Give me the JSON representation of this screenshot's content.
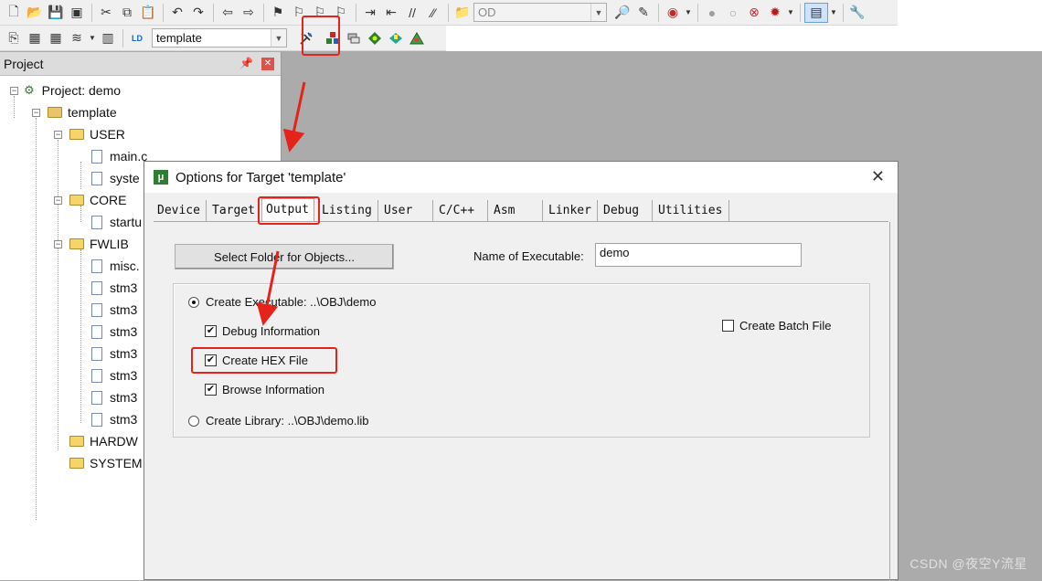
{
  "toolbar": {
    "device_combo_value": "OD",
    "target_combo_value": "template",
    "icons_row1": [
      "new-file-icon",
      "open-folder-icon",
      "save-icon",
      "save-all-icon",
      "cut-icon",
      "copy-icon",
      "paste-icon",
      "undo-icon",
      "redo-icon",
      "nav-back-icon",
      "nav-forward-icon",
      "bookmark-icon",
      "prev-bookmark-icon",
      "next-bookmark-icon",
      "clear-bookmarks-icon",
      "indent-icon",
      "outdent-icon",
      "comment-icon",
      "uncomment-icon",
      "find-in-files-icon"
    ],
    "icons_row2": [
      "translate-icon",
      "build-icon",
      "rebuild-icon",
      "batch-build-icon",
      "stop-build-icon",
      "download-icon"
    ]
  },
  "project": {
    "title": "Project",
    "tree": [
      {
        "label": "Project: demo"
      },
      {
        "label": "template"
      },
      {
        "label": "USER"
      },
      {
        "label": "main.c"
      },
      {
        "label": "syste"
      },
      {
        "label": "CORE"
      },
      {
        "label": "startu"
      },
      {
        "label": "FWLIB"
      },
      {
        "label": "misc."
      },
      {
        "label": "stm3"
      },
      {
        "label": "stm3"
      },
      {
        "label": "stm3"
      },
      {
        "label": "stm3"
      },
      {
        "label": "stm3"
      },
      {
        "label": "stm3"
      },
      {
        "label": "stm3"
      },
      {
        "label": "HARDW"
      },
      {
        "label": "SYSTEM"
      }
    ]
  },
  "dialog": {
    "title": "Options for Target 'template'",
    "tabs": [
      "Device",
      "Target",
      "Output",
      "Listing",
      "User",
      "C/C++",
      "Asm",
      "Linker",
      "Debug",
      "Utilities"
    ],
    "active_tab": "Output",
    "select_folder_button": "Select Folder for Objects...",
    "name_of_executable_label": "Name of Executable:",
    "name_of_executable_value": "demo",
    "create_executable_label": "Create Executable:  ..\\OBJ\\demo",
    "create_executable_selected": true,
    "debug_information_label": "Debug Information",
    "debug_information_checked": true,
    "create_hex_label": "Create HEX File",
    "create_hex_checked": true,
    "browse_information_label": "Browse Information",
    "browse_information_checked": true,
    "create_library_label": "Create Library:  ..\\OBJ\\demo.lib",
    "create_library_selected": false,
    "create_batch_label": "Create Batch File",
    "create_batch_checked": false
  },
  "watermark": "CSDN @夜空Y流星",
  "colors": {
    "highlight": "#e5231b",
    "dialog_bg": "#f0f0f0",
    "workspace_bg": "#ababab"
  }
}
